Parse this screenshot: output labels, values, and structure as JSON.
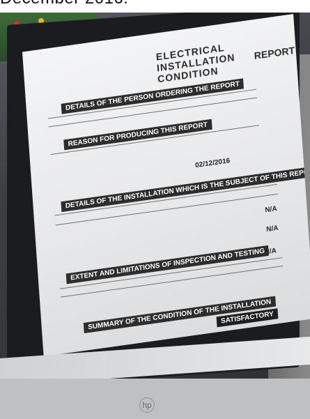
{
  "caption": {
    "text": "December 2016."
  },
  "document": {
    "title_line1": "ELECTRICAL INSTALLATION CONDITION",
    "title_line2": "REPORT",
    "section_a": "DETAILS OF THE PERSON ORDERING THE REPORT",
    "section_b": "REASON FOR PRODUCING THIS REPORT",
    "section_c": "DETAILS OF THE INSTALLATION WHICH IS THE SUBJECT OF THIS REPORT",
    "section_d": "EXTENT AND LIMITATIONS OF INSPECTION AND TESTING",
    "section_e": "SUMMARY OF THE CONDITION OF THE INSTALLATION",
    "date": "02/12/2016",
    "na_1": "N/A",
    "na_2": "N/A",
    "na_3": "N/A",
    "status": "SATISFACTORY"
  },
  "monitor": {
    "logo": "hp"
  }
}
